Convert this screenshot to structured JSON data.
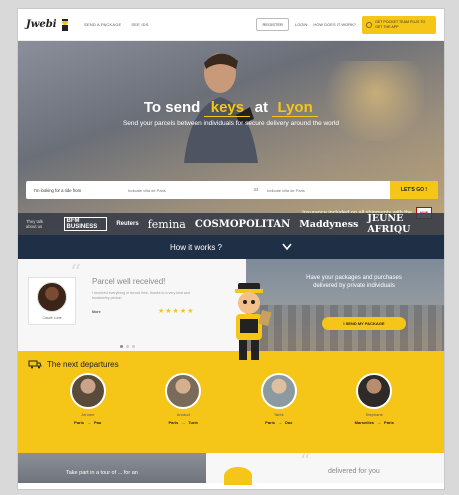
{
  "header": {
    "logo_text": "Jwebi",
    "nav": [
      "SEND A PACKAGE",
      "SEE IDS"
    ],
    "register": "REGISTER",
    "login": "LOGIN",
    "how_link": "HOW DOES IT WORK?",
    "promo": "GET POCKET TEAM PLUS TO GET THE APP"
  },
  "hero": {
    "title_prefix": "To send",
    "title_keyword": "keys",
    "title_mid": "at",
    "title_city": "Lyon",
    "subtitle": "Send your parcels between individuals for secure delivery around the world",
    "search_label": "I'm looking for a ride from",
    "from_placeholder": "Indicate villa de Paris",
    "to_placeholder": "Indicate villa de Paris",
    "separator": "at",
    "search_button": "LET'S GO !",
    "insurance_text": "Insurance included on all shipments with the",
    "insurance_badge": "MAIF"
  },
  "press": {
    "label": "They talk about us",
    "logos": [
      "BFM BUSINESS",
      "Reuters",
      "femina",
      "COSMOPOLITAN",
      "Maddyness",
      "JEUNE AFRIQU"
    ]
  },
  "how_it_works": {
    "label": "How it works ?"
  },
  "testimonial": {
    "name": "Carole Lune",
    "title": "Parcel well received!",
    "body": "I received everything in record time, thanks to a very kind and trustworthy person",
    "more": "More",
    "stars": "★★★★★",
    "right_message": "Have your packages and purchases delivered by private individuals",
    "cta": "I SEND MY PACKAGE"
  },
  "departures": {
    "title": "The next departures",
    "items": [
      {
        "name": "Jerome",
        "from": "Paris",
        "to": "Pau",
        "color": "#5a4a3a"
      },
      {
        "name": "Arnaud",
        "from": "Paris",
        "to": "Turin",
        "color": "#7a6a5a"
      },
      {
        "name": "Tarek",
        "from": "Paris",
        "to": "Dax",
        "color": "#8a9aa0"
      },
      {
        "name": "Stephane",
        "from": "Marseilles",
        "to": "Paris",
        "color": "#2e2a28"
      }
    ],
    "arrow": "→"
  },
  "bottom": {
    "left_text": "Take part in a tour of ... for an",
    "right_text": "delivered for you"
  },
  "colors": {
    "accent": "#f5c518",
    "navy": "#1f2f45"
  }
}
